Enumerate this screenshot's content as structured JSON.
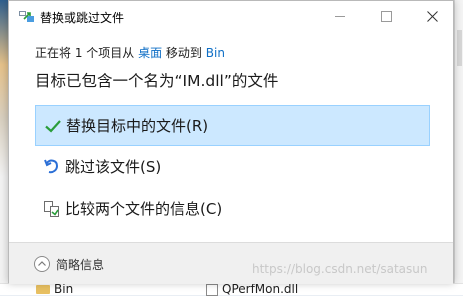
{
  "window": {
    "title": "替换或跳过文件"
  },
  "transfer": {
    "prefix": "正在将 1 个项目从 ",
    "source": "桌面",
    "middle": " 移动到 ",
    "destination": "Bin"
  },
  "heading": "目标已包含一个名为“IM.dll”的文件",
  "options": [
    {
      "label": "替换目标中的文件(R)",
      "icon": "checkmark-icon"
    },
    {
      "label": "跳过该文件(S)",
      "icon": "skip-icon"
    },
    {
      "label": "比较两个文件的信息(C)",
      "icon": "compare-icon"
    }
  ],
  "footer": {
    "details_label": "简略信息"
  },
  "watermark": "https://blog.csdn.net/satasun",
  "background": {
    "left_item": "Bin",
    "right_item": "QPerfMon.dll"
  },
  "colors": {
    "accent": "#0f6fc6",
    "selected_bg": "#cce8ff",
    "check": "#2a9d3a"
  }
}
